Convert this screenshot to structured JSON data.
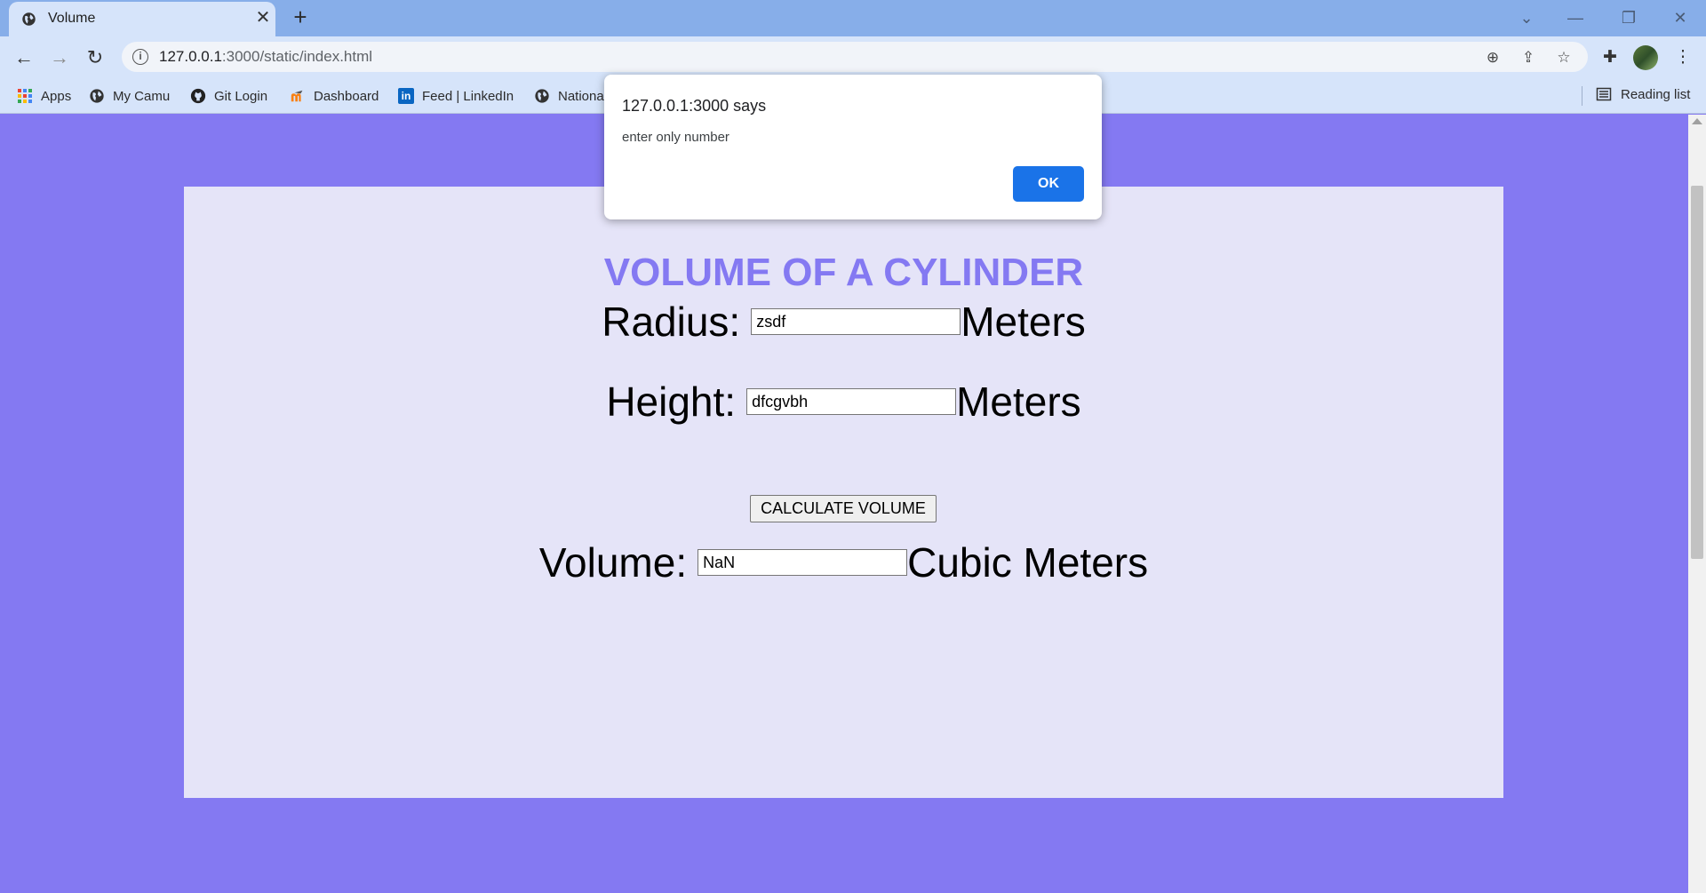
{
  "browser": {
    "tab_title": "Volume",
    "tab_close": "✕",
    "new_tab": "+",
    "url_host": "127.0.0.1",
    "url_rest": ":3000/static/index.html",
    "bookmarks": [
      {
        "label": "Apps",
        "icon": "apps-icon"
      },
      {
        "label": "My Camu",
        "icon": "globe-icon"
      },
      {
        "label": "Git Login",
        "icon": "github-icon"
      },
      {
        "label": "Dashboard",
        "icon": "moodle-icon"
      },
      {
        "label": "Feed | LinkedIn",
        "icon": "linkedin-icon"
      },
      {
        "label": "Nationa",
        "icon": "globe-icon"
      }
    ],
    "reading_list": "Reading list"
  },
  "page": {
    "title": "VOLUME OF A CYLINDER",
    "radius_label": "Radius:",
    "radius_value": "zsdf",
    "radius_unit": "Meters",
    "height_label": "Height:",
    "height_value": "dfcgvbh",
    "height_unit": "Meters",
    "calculate_label": "CALCULATE VOLUME",
    "volume_label": "Volume:",
    "volume_value": "NaN",
    "volume_unit": "Cubic Meters"
  },
  "dialog": {
    "title": "127.0.0.1:3000 says",
    "message": "enter only number",
    "ok_label": "OK"
  },
  "colors": {
    "page_bg": "#8479f2",
    "card_bg": "#e5e4f8",
    "title_color": "#8479f2",
    "ok_button": "#1a73e8"
  }
}
